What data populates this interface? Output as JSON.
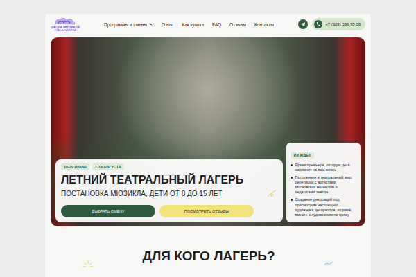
{
  "header": {
    "logo": {
      "title": "ШКОЛА МЮЗИКЛА",
      "subtitle": "СТАСА НАМИНА"
    },
    "nav": [
      {
        "label": "Программы и смены",
        "dropdown": true
      },
      {
        "label": "О нас",
        "dropdown": false
      },
      {
        "label": "Как купить",
        "dropdown": false
      },
      {
        "label": "FAQ",
        "dropdown": false
      },
      {
        "label": "Отзывы",
        "dropdown": false
      },
      {
        "label": "Контакты",
        "dropdown": false
      }
    ],
    "phone": "+7 (926) 536 75 08"
  },
  "hero": {
    "dates": [
      "16-29 ИЮЛЯ",
      "1-14 АВГУСТА"
    ],
    "title": "ЛЕТНИЙ ТЕАТРАЛЬНЫЙ ЛАГЕРЬ",
    "subtitle": "ПОСТАНОВКА МЮЗИКЛА, ДЕТИ ОТ 8 ДО 15 ЛЕТ",
    "buttons": [
      {
        "label": "ВЫБРАТЬ СМЕНУ",
        "kind": "primary"
      },
      {
        "label": "ПОСМОТРЕТЬ ОТЗЫВЫ",
        "kind": "secondary"
      }
    ]
  },
  "expect": {
    "label": "ИХ ЖДЕТ",
    "items": [
      "Яркая премьера, которую дети запомнят на всю жизнь",
      "Погружение в театральный мир, репетиции с артистами Московских мюзиклов и педагогами театра",
      "Создание декораций под присмотром настоящего художника декоратора, и грима, вместе с художником по гриму"
    ]
  },
  "section": {
    "title": "ДЛЯ КОГО ЛАГЕРЬ?"
  }
}
